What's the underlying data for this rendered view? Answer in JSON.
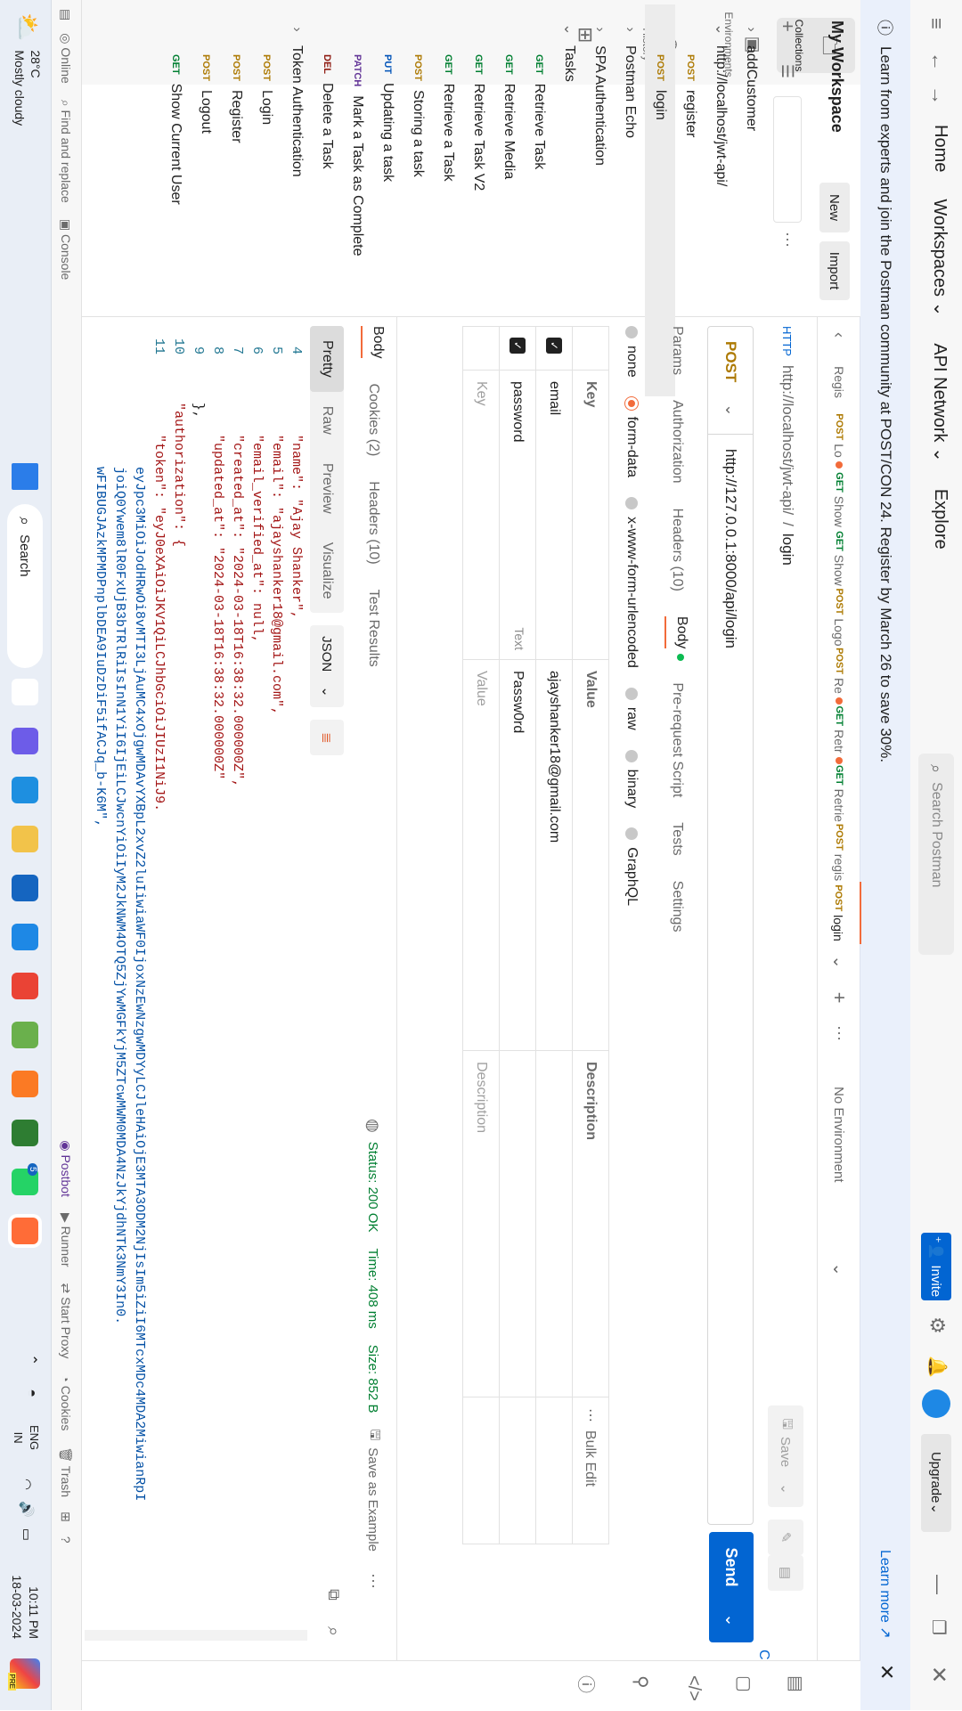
{
  "nav": {
    "home": "Home",
    "workspaces": "Workspaces",
    "api_network": "API Network",
    "explore": "Explore",
    "search_placeholder": "Search Postman",
    "invite": "Invite",
    "upgrade": "Upgrade"
  },
  "banner": {
    "text": "Learn from experts and join the Postman community at POST/CON 24. Register by March 26 to save 30%.",
    "link": "Learn more ↗"
  },
  "sidebar": {
    "items": [
      "Collections",
      "Environments",
      "History"
    ]
  },
  "workspace": {
    "title": "My Workspace",
    "new": "New",
    "import": "Import"
  },
  "tree": [
    {
      "label": "addCustomer",
      "indent": 0,
      "method": ""
    },
    {
      "label": "http://localhost/jwt-api/",
      "indent": 0,
      "method": ""
    },
    {
      "label": "register",
      "indent": 1,
      "method": "POST"
    },
    {
      "label": "login",
      "indent": 1,
      "method": "POST",
      "active": true
    },
    {
      "label": "Postman Echo",
      "indent": 0,
      "method": ""
    },
    {
      "label": "SPA Authentication",
      "indent": 0,
      "method": ""
    },
    {
      "label": "Tasks",
      "indent": 0,
      "method": ""
    },
    {
      "label": "Retrieve Task",
      "indent": 1,
      "method": "GET"
    },
    {
      "label": "Retrieve Media",
      "indent": 1,
      "method": "GET"
    },
    {
      "label": "Retrieve Task V2",
      "indent": 1,
      "method": "GET"
    },
    {
      "label": "Retrieve a Task",
      "indent": 1,
      "method": "GET"
    },
    {
      "label": "Storing a task",
      "indent": 1,
      "method": "POST"
    },
    {
      "label": "Updating a task",
      "indent": 1,
      "method": "PUT"
    },
    {
      "label": "Mark a Task as Complete",
      "indent": 1,
      "method": "PATCH"
    },
    {
      "label": "Delete a Task",
      "indent": 1,
      "method": "DEL"
    },
    {
      "label": "Token Authentication",
      "indent": 0,
      "method": ""
    },
    {
      "label": "Login",
      "indent": 1,
      "method": "POST"
    },
    {
      "label": "Register",
      "indent": 1,
      "method": "POST"
    },
    {
      "label": "Logout",
      "indent": 1,
      "method": "POST"
    },
    {
      "label": "Show Current User",
      "indent": 1,
      "method": "GET"
    }
  ],
  "tabs": [
    {
      "method": "",
      "label": "Regis"
    },
    {
      "method": "POST",
      "label": "Lo",
      "dot": true
    },
    {
      "method": "GET",
      "label": "Show"
    },
    {
      "method": "GET",
      "label": "Show"
    },
    {
      "method": "POST",
      "label": "Logo"
    },
    {
      "method": "POST",
      "label": "Re",
      "dot": true
    },
    {
      "method": "GET",
      "label": "Retr",
      "dot": true
    },
    {
      "method": "GET",
      "label": "Retrie"
    },
    {
      "method": "POST",
      "label": "regis"
    },
    {
      "method": "POST",
      "label": "login",
      "active": true
    }
  ],
  "environment": "No Environment",
  "breadcrumb": {
    "parent": "http://localhost/jwt-api/",
    "sep": "/",
    "current": "login",
    "save": "Save"
  },
  "request": {
    "method": "POST",
    "url": "http://127.0.0.1:8000/api/login",
    "send": "Send",
    "cookies": "Cookies"
  },
  "req_tabs": [
    "Params",
    "Authorization",
    "Headers (10)",
    "Body",
    "Pre-request Script",
    "Tests",
    "Settings"
  ],
  "body_types": [
    "none",
    "form-data",
    "x-www-form-urlencoded",
    "raw",
    "binary",
    "GraphQL"
  ],
  "form": {
    "headers": {
      "key": "Key",
      "value": "Value",
      "description": "Description",
      "bulk_edit": "Bulk Edit"
    },
    "rows": [
      {
        "key": "email",
        "value": "ajayshanker18@gmail.com",
        "type": ""
      },
      {
        "key": "password",
        "value": "Passw0rd",
        "type": "Text"
      }
    ],
    "placeholder": {
      "key": "Key",
      "value": "Value",
      "description": "Description"
    }
  },
  "response": {
    "tabs": [
      "Body",
      "Cookies (2)",
      "Headers (10)",
      "Test Results"
    ],
    "status": "Status: 200 OK",
    "time": "Time: 408 ms",
    "size": "Size: 852 B",
    "save_example": "Save as Example",
    "view_modes": [
      "Pretty",
      "Raw",
      "Preview",
      "Visualize"
    ],
    "format": "JSON",
    "lines": [
      {
        "n": "4",
        "text": "        \"name\": \"Ajay Shanker\","
      },
      {
        "n": "5",
        "text": "        \"email\": \"ajayshanker18@gmail.com\","
      },
      {
        "n": "6",
        "text": "        \"email_verified_at\": null,"
      },
      {
        "n": "7",
        "text": "        \"created_at\": \"2024-03-18T16:38:32.000000Z\","
      },
      {
        "n": "8",
        "text": "        \"updated_at\": \"2024-03-18T16:38:32.000000Z\""
      },
      {
        "n": "9",
        "text": "    },"
      },
      {
        "n": "10",
        "text": "    \"authorization\": {"
      },
      {
        "n": "11",
        "text": "        \"token\": \"eyJ0eXAiOiJKV1QiLCJhbGciOiJIUzI1NiJ9."
      },
      {
        "n": "",
        "text": "            eyJpc3MiOiJodHRwOi8vMTI3LjAuMC4xOjgwMDAvYXBpL2xvZ2luIiwiaWF0IjoxNzEwNzgwMDYyLCJleHAiOjE3MTA3ODM2NjIsIm5iZiI6MTcxMDc4MDA2MiwianRpI"
      },
      {
        "n": "",
        "text": "            joiQ0Ywem8lR0FxUjB3bTRlRiIsInN1YiI6IjEiLCJwcnYiOiIyM2JkNWM4OTQ5ZjYwMGFkYjM5ZTcwMWM0MDA4NzJkYjdhNTk3NmY3In0."
      },
      {
        "n": "",
        "text": "            wFIBUGJAzkMPMDPnplbDEA9IuDzDiF5ifACJq_b-K6M\","
      }
    ]
  },
  "statusbar": {
    "online": "Online",
    "find": "Find and replace",
    "console": "Console",
    "postbot": "Postbot",
    "runner": "Runner",
    "proxy": "Start Proxy",
    "cookies": "Cookies",
    "trash": "Trash"
  },
  "taskbar": {
    "weather_temp": "28°C",
    "weather_desc": "Mostly cloudy",
    "search": "Search",
    "lang": "ENG",
    "region": "IN",
    "time": "10:11 PM",
    "date": "18-03-2024",
    "chat_badge": "5",
    "pre": "PRE"
  }
}
